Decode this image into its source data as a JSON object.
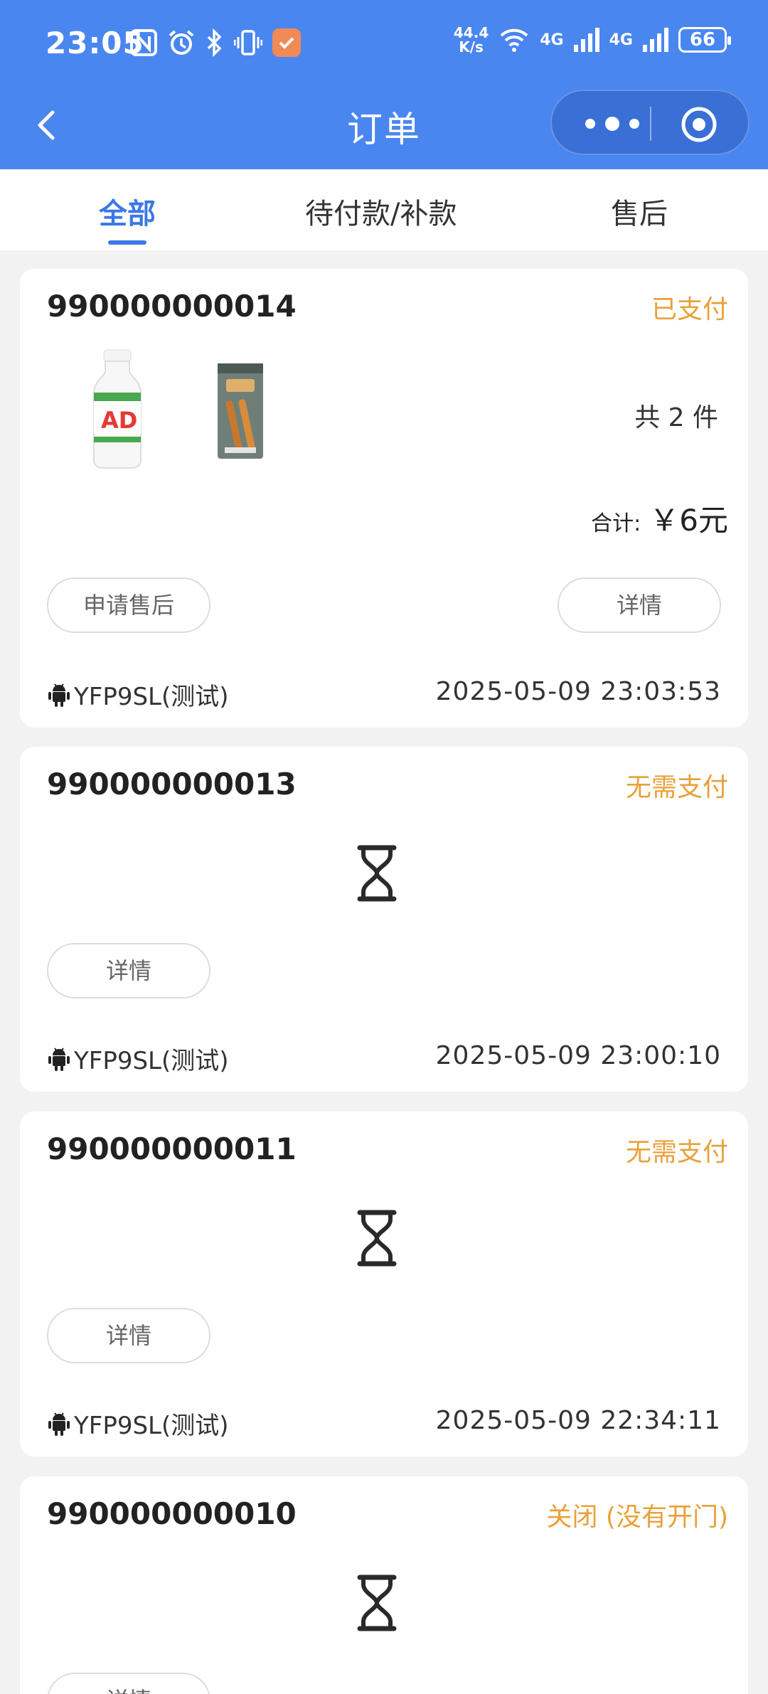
{
  "status_bar": {
    "time": "23:05",
    "speed_top": "44.4",
    "speed_bottom": "K/s",
    "net1": "4G",
    "net2": "4G",
    "battery": "66",
    "icons": [
      "nfc-icon",
      "alarm-icon",
      "bluetooth-icon",
      "vibrate-icon",
      "app-notification-icon",
      "wifi-icon",
      "signal-icon"
    ]
  },
  "nav": {
    "title": "订单"
  },
  "tabs": [
    {
      "label": "全部",
      "active": true
    },
    {
      "label": "待付款/补款",
      "active": false
    },
    {
      "label": "售后",
      "active": false
    }
  ],
  "orders": [
    {
      "id": "990000000014",
      "status": "已支付",
      "qty_text": "共 2 件",
      "total_label": "合计:",
      "total_value": "￥6元",
      "left_button": "申请售后",
      "right_button": "详情",
      "device": "YFP9SL(测试)",
      "time": "2025-05-09 23:03:53",
      "products": [
        "ad-calcium-milk-bottle",
        "snack-stick-pack"
      ]
    },
    {
      "id": "990000000013",
      "status": "无需支付",
      "button": "详情",
      "device": "YFP9SL(测试)",
      "time": "2025-05-09 23:00:10"
    },
    {
      "id": "990000000011",
      "status": "无需支付",
      "button": "详情",
      "device": "YFP9SL(测试)",
      "time": "2025-05-09 22:34:11"
    },
    {
      "id": "990000000010",
      "status": "关闭 (没有开门)",
      "button": "详情"
    }
  ],
  "colors": {
    "primary": "#4a86f0",
    "accent_tab": "#3b78e7",
    "status": "#e8a13a",
    "background": "#f2f2f2"
  }
}
